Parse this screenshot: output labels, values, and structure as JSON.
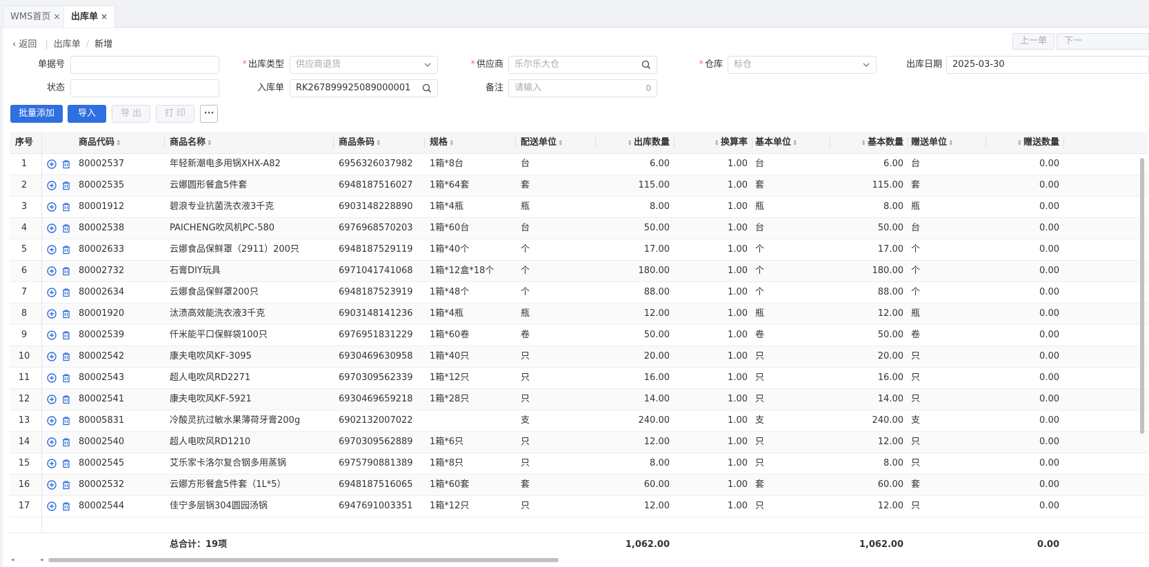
{
  "tabs": [
    {
      "label": "WMS首页",
      "close": "×"
    },
    {
      "label": "出库单",
      "close": "×"
    }
  ],
  "breadcrumb": {
    "back": "返回",
    "parent": "出库单",
    "separator": "/",
    "current": "新增"
  },
  "nav": {
    "prev": "上一单",
    "next": "下一"
  },
  "form": {
    "order_no": {
      "label": "单据号",
      "value": ""
    },
    "out_type": {
      "label": "出库类型",
      "placeholder": "供应商退货",
      "required": "*"
    },
    "supplier": {
      "label": "供应商",
      "placeholder": "乐尔乐大仓",
      "required": "*"
    },
    "warehouse": {
      "label": "仓库",
      "placeholder": "标仓",
      "required": "*"
    },
    "out_date": {
      "label": "出库日期",
      "value": "2025-03-30"
    },
    "status": {
      "label": "状态",
      "value": ""
    },
    "in_order": {
      "label": "入库单",
      "value": "RK267899925089000001"
    },
    "remark": {
      "label": "备注",
      "placeholder": "请输入",
      "count": "0"
    }
  },
  "toolbar": {
    "batch_add": "批量添加",
    "import": "导入",
    "export": "导 出",
    "print": "打 印",
    "more": "···"
  },
  "table": {
    "headers": {
      "seq": "序号",
      "code": "商品代码",
      "name": "商品名称",
      "barcode": "商品条码",
      "spec": "规格",
      "unit": "配送单位",
      "qty": "出库数量",
      "rate": "换算率",
      "base_unit": "基本单位",
      "base_qty": "基本数量",
      "gift_unit": "赠送单位",
      "gift_qty": "赠送数量"
    },
    "rows": [
      {
        "seq": "1",
        "code": "80002537",
        "name": "年轻新潮电多用锅XHX-A82",
        "barcode": "6956326037982",
        "spec": "1箱*8台",
        "unit": "台",
        "qty": "6.00",
        "rate": "1.00",
        "base_unit": "台",
        "base_qty": "6.00",
        "gift_unit": "台",
        "gift_qty": "0.00"
      },
      {
        "seq": "2",
        "code": "80002535",
        "name": "云娜圆形餐盒5件套",
        "barcode": "6948187516027",
        "spec": "1箱*64套",
        "unit": "套",
        "qty": "115.00",
        "rate": "1.00",
        "base_unit": "套",
        "base_qty": "115.00",
        "gift_unit": "套",
        "gift_qty": "0.00"
      },
      {
        "seq": "3",
        "code": "80001912",
        "name": "碧浪专业抗菌洗衣液3千克",
        "barcode": "6903148228890",
        "spec": "1箱*4瓶",
        "unit": "瓶",
        "qty": "8.00",
        "rate": "1.00",
        "base_unit": "瓶",
        "base_qty": "8.00",
        "gift_unit": "瓶",
        "gift_qty": "0.00"
      },
      {
        "seq": "4",
        "code": "80002538",
        "name": "PAICHENG吹风机PC-580",
        "barcode": "6976968570203",
        "spec": "1箱*60台",
        "unit": "台",
        "qty": "50.00",
        "rate": "1.00",
        "base_unit": "台",
        "base_qty": "50.00",
        "gift_unit": "台",
        "gift_qty": "0.00"
      },
      {
        "seq": "5",
        "code": "80002633",
        "name": "云娜食品保鲜罩（2911）200只",
        "barcode": "6948187529119",
        "spec": "1箱*40个",
        "unit": "个",
        "qty": "17.00",
        "rate": "1.00",
        "base_unit": "个",
        "base_qty": "17.00",
        "gift_unit": "个",
        "gift_qty": "0.00"
      },
      {
        "seq": "6",
        "code": "80002732",
        "name": "石膏DIY玩具",
        "barcode": "6971041741068",
        "spec": "1箱*12盒*18个",
        "unit": "个",
        "qty": "180.00",
        "rate": "1.00",
        "base_unit": "个",
        "base_qty": "180.00",
        "gift_unit": "个",
        "gift_qty": "0.00"
      },
      {
        "seq": "7",
        "code": "80002634",
        "name": "云娜食品保鲜罩200只",
        "barcode": "6948187523919",
        "spec": "1箱*48个",
        "unit": "个",
        "qty": "88.00",
        "rate": "1.00",
        "base_unit": "个",
        "base_qty": "88.00",
        "gift_unit": "个",
        "gift_qty": "0.00"
      },
      {
        "seq": "8",
        "code": "80001920",
        "name": "汰渍高效能洗衣液3千克",
        "barcode": "6903148141236",
        "spec": "1箱*4瓶",
        "unit": "瓶",
        "qty": "12.00",
        "rate": "1.00",
        "base_unit": "瓶",
        "base_qty": "12.00",
        "gift_unit": "瓶",
        "gift_qty": "0.00"
      },
      {
        "seq": "9",
        "code": "80002539",
        "name": "仟米能平口保鲜袋100只",
        "barcode": "6976951831229",
        "spec": "1箱*60卷",
        "unit": "卷",
        "qty": "50.00",
        "rate": "1.00",
        "base_unit": "卷",
        "base_qty": "50.00",
        "gift_unit": "卷",
        "gift_qty": "0.00"
      },
      {
        "seq": "10",
        "code": "80002542",
        "name": "康夫电吹风KF-3095",
        "barcode": "6930469630958",
        "spec": "1箱*40只",
        "unit": "只",
        "qty": "20.00",
        "rate": "1.00",
        "base_unit": "只",
        "base_qty": "20.00",
        "gift_unit": "只",
        "gift_qty": "0.00"
      },
      {
        "seq": "11",
        "code": "80002543",
        "name": "超人电吹风RD2271",
        "barcode": "6970309562339",
        "spec": "1箱*12只",
        "unit": "只",
        "qty": "16.00",
        "rate": "1.00",
        "base_unit": "只",
        "base_qty": "16.00",
        "gift_unit": "只",
        "gift_qty": "0.00"
      },
      {
        "seq": "12",
        "code": "80002541",
        "name": "康夫电吹风KF-5921",
        "barcode": "6930469659218",
        "spec": "1箱*28只",
        "unit": "只",
        "qty": "14.00",
        "rate": "1.00",
        "base_unit": "只",
        "base_qty": "14.00",
        "gift_unit": "只",
        "gift_qty": "0.00"
      },
      {
        "seq": "13",
        "code": "80005831",
        "name": "冷酸灵抗过敏水果薄荷牙膏200g",
        "barcode": "6902132007022",
        "spec": "",
        "unit": "支",
        "qty": "240.00",
        "rate": "1.00",
        "base_unit": "支",
        "base_qty": "240.00",
        "gift_unit": "支",
        "gift_qty": "0.00"
      },
      {
        "seq": "14",
        "code": "80002540",
        "name": "超人电吹风RD1210",
        "barcode": "6970309562889",
        "spec": "1箱*6只",
        "unit": "只",
        "qty": "12.00",
        "rate": "1.00",
        "base_unit": "只",
        "base_qty": "12.00",
        "gift_unit": "只",
        "gift_qty": "0.00"
      },
      {
        "seq": "15",
        "code": "80002545",
        "name": "艾乐家卡洛尔复合钢多用蒸锅",
        "barcode": "6975790881389",
        "spec": "1箱*8只",
        "unit": "只",
        "qty": "8.00",
        "rate": "1.00",
        "base_unit": "只",
        "base_qty": "8.00",
        "gift_unit": "只",
        "gift_qty": "0.00"
      },
      {
        "seq": "16",
        "code": "80002532",
        "name": "云娜方形餐盒5件套（1L*5）",
        "barcode": "6948187516065",
        "spec": "1箱*60套",
        "unit": "套",
        "qty": "60.00",
        "rate": "1.00",
        "base_unit": "套",
        "base_qty": "60.00",
        "gift_unit": "套",
        "gift_qty": "0.00"
      },
      {
        "seq": "17",
        "code": "80002544",
        "name": "佳宁多层锅304圆园汤锅",
        "barcode": "6947691003351",
        "spec": "1箱*12只",
        "unit": "只",
        "qty": "12.00",
        "rate": "1.00",
        "base_unit": "只",
        "base_qty": "12.00",
        "gift_unit": "只",
        "gift_qty": "0.00"
      }
    ],
    "footer": {
      "label": "总合计：19项",
      "qty_total": "1,062.00",
      "base_qty_total": "1,062.00",
      "gift_qty_total": "0.00"
    }
  },
  "icons": {
    "back": "chevron-left-icon",
    "search": "search-icon",
    "dropdown": "chevron-down-icon",
    "add": "plus-circle-icon",
    "delete": "trash-icon",
    "sort": "sort-icon",
    "calendar": "calendar-icon"
  },
  "colors": {
    "primary": "#2f6fe0",
    "required": "#f56c6c",
    "row_icon": "#2f6fe0"
  }
}
